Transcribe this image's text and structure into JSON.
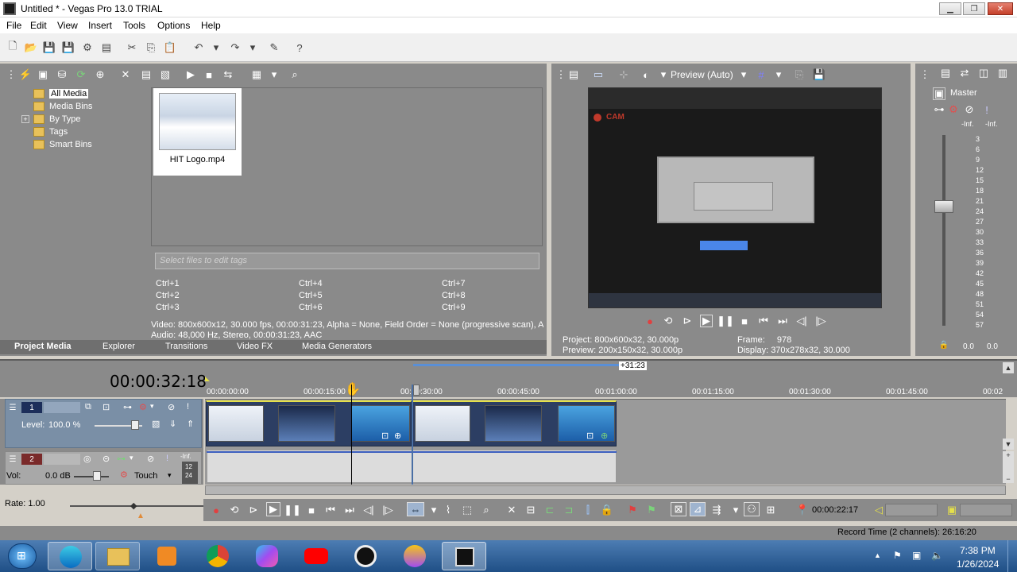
{
  "window": {
    "title": "Untitled * - Vegas Pro 13.0 TRIAL",
    "minimize_glyph": "▁",
    "maximize_glyph": "❐",
    "close_glyph": "✕"
  },
  "menu": [
    "File",
    "Edit",
    "View",
    "Insert",
    "Tools",
    "Options",
    "Help"
  ],
  "explorer": {
    "tree": [
      "All Media",
      "Media Bins",
      "By Type",
      "Tags",
      "Smart Bins"
    ],
    "expand_glyph": "+",
    "media_file": "HIT Logo.mp4",
    "tags_placeholder": "Select files to edit tags",
    "shortcuts": [
      "Ctrl+1",
      "Ctrl+4",
      "Ctrl+7",
      "Ctrl+2",
      "Ctrl+5",
      "Ctrl+8",
      "Ctrl+3",
      "Ctrl+6",
      "Ctrl+9"
    ],
    "video_info": "Video: 800x600x12, 30.000 fps, 00:00:31:23, Alpha = None, Field Order = None (progressive scan), A",
    "audio_info": "Audio: 48,000 Hz, Stereo, 00:00:31:23, AAC",
    "tabs": [
      "Project Media",
      "Explorer",
      "Transitions",
      "Video FX",
      "Media Generators"
    ]
  },
  "preview": {
    "mode_label": "Preview (Auto)",
    "project_label": "Project:",
    "project_value": "800x600x32, 30.000p",
    "preview_label": "Preview:",
    "preview_value": "200x150x32, 30.000p",
    "frame_label": "Frame:",
    "frame_value": "978",
    "display_label": "Display:",
    "display_value": "370x278x32, 30.000",
    "screen_brand": "CAM"
  },
  "mixer": {
    "title": "Master",
    "inf_left": "-Inf.",
    "inf_right": "-Inf.",
    "scale": [
      "3",
      "6",
      "9",
      "12",
      "15",
      "18",
      "21",
      "24",
      "27",
      "30",
      "33",
      "36",
      "39",
      "42",
      "45",
      "48",
      "51",
      "54",
      "57"
    ],
    "bottom_left": "0.0",
    "bottom_right": "0.0"
  },
  "timeline": {
    "current_time": "00:00:32:18",
    "loop_length": "+31:23",
    "ruler_ticks": [
      "00:00:00:00",
      "00:00:15:00",
      "00:00:30:00",
      "00:00:45:00",
      "00:01:00:00",
      "00:01:15:00",
      "00:01:30:00",
      "00:01:45:00",
      "00:02"
    ],
    "video_track": {
      "number": "1",
      "level_label": "Level:",
      "level_value": "100.0 %"
    },
    "audio_track": {
      "number": "2",
      "vol_label": "Vol:",
      "vol_value": "0.0 dB",
      "touch_label": "Touch",
      "inf_label": "-Inf.",
      "meter_a": "12",
      "meter_b": "24"
    },
    "rate_label": "Rate: 1.00",
    "cursor_time": "00:00:22:17",
    "record_time": "Record Time (2 channels): 26:16:20"
  },
  "taskbar": {
    "time": "7:38 PM",
    "date": "1/26/2024"
  },
  "colors": {
    "panel": "#8a8a8a",
    "accent": "#2c3e63",
    "taskbar": "#1f4f86"
  }
}
